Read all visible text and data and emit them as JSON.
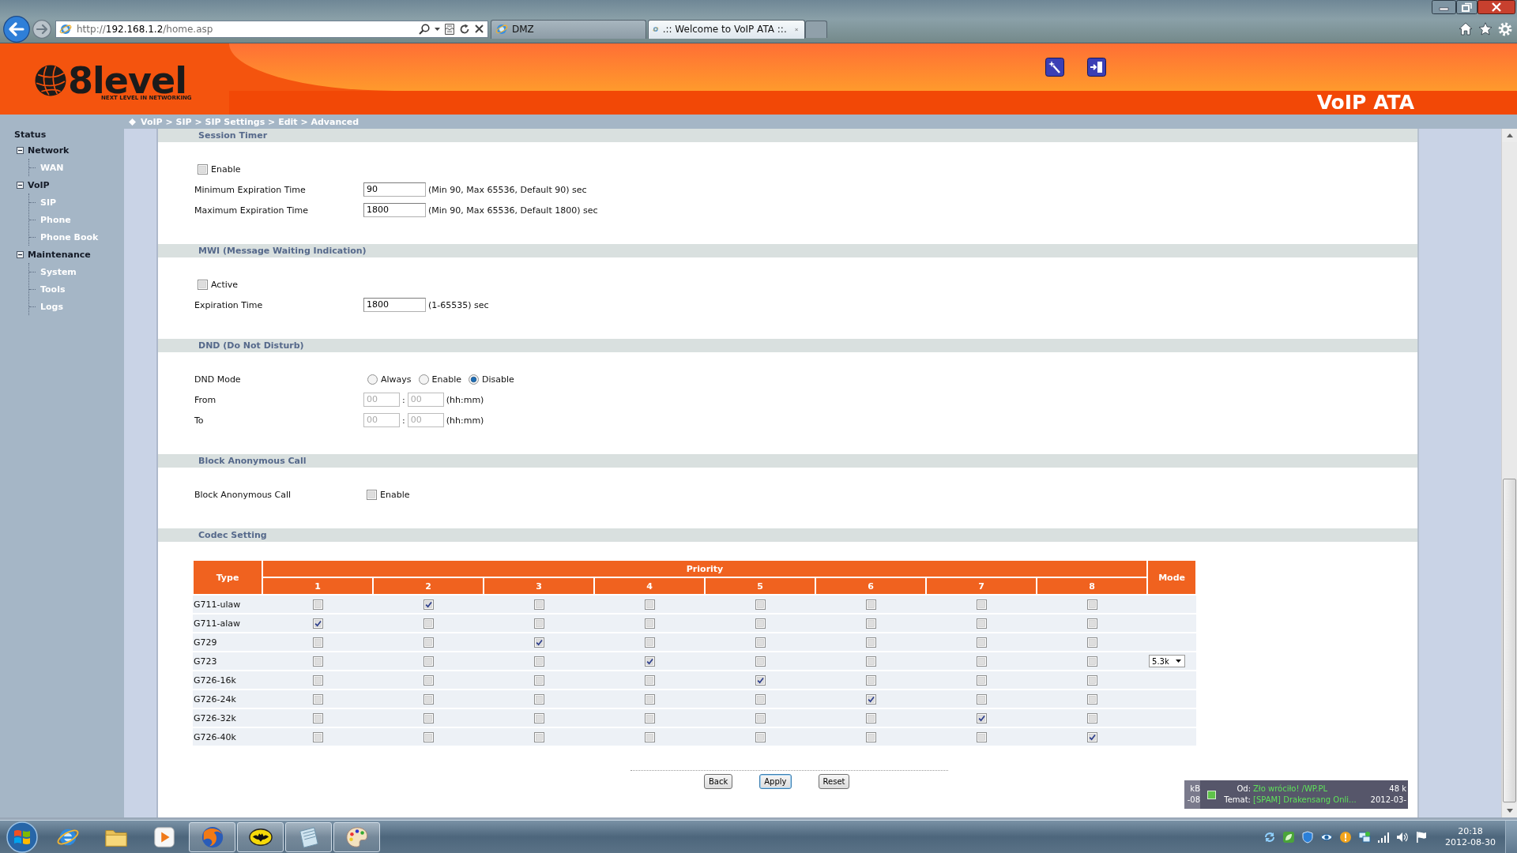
{
  "browser": {
    "address": {
      "scheme": "http://",
      "host": "192.168.1.2",
      "path": "/home.asp"
    },
    "tabs": [
      {
        "label": "DMZ",
        "selected": false
      },
      {
        "label": ".:: Welcome to VoIP ATA ::.",
        "selected": true
      }
    ]
  },
  "header": {
    "logo": "8level",
    "tagline": "NEXT LEVEL IN NETWORKING",
    "product": "VoIP ATA"
  },
  "breadcrumb": "VoIP > SIP > SIP Settings > Edit > Advanced",
  "sidebar": {
    "title": "Status",
    "items": [
      {
        "label": "Network",
        "expanded": true,
        "children": [
          {
            "label": "WAN"
          }
        ]
      },
      {
        "label": "VoIP",
        "expanded": true,
        "children": [
          {
            "label": "SIP"
          },
          {
            "label": "Phone"
          },
          {
            "label": "Phone Book"
          }
        ]
      },
      {
        "label": "Maintenance",
        "expanded": true,
        "children": [
          {
            "label": "System"
          },
          {
            "label": "Tools"
          },
          {
            "label": "Logs"
          }
        ]
      }
    ]
  },
  "sections": [
    {
      "title": "Session Timer",
      "rows": [
        {
          "kind": "checkbox",
          "label": "Enable",
          "checked": false
        },
        {
          "kind": "text",
          "label": "Minimum Expiration Time",
          "value": "90",
          "note": "(Min 90, Max 65536, Default 90) sec"
        },
        {
          "kind": "text",
          "label": "Maximum Expiration Time",
          "value": "1800",
          "note": "(Min 90, Max 65536, Default 1800) sec"
        }
      ]
    },
    {
      "title": "MWI (Message Waiting Indication)",
      "rows": [
        {
          "kind": "checkbox",
          "label": "Active",
          "checked": false
        },
        {
          "kind": "text",
          "label": "Expiration Time",
          "value": "1800",
          "note": "(1-65535) sec"
        }
      ]
    },
    {
      "title": "DND (Do Not Disturb)",
      "rows": [
        {
          "kind": "radio",
          "label": "DND Mode",
          "options": [
            {
              "label": "Always",
              "selected": false
            },
            {
              "label": "Enable",
              "selected": false
            },
            {
              "label": "Disable",
              "selected": true
            }
          ]
        },
        {
          "kind": "time",
          "label": "From",
          "hours": "00",
          "separator": ":",
          "minutes": "00",
          "note": "(hh:mm)",
          "disabled": true
        },
        {
          "kind": "time",
          "label": "To",
          "hours": "00",
          "separator": ":",
          "minutes": "00",
          "note": "(hh:mm)",
          "disabled": true
        }
      ]
    },
    {
      "title": "Block Anonymous Call",
      "rows": [
        {
          "kind": "option",
          "label": "Block Anonymous Call",
          "option": "Enable",
          "checked": false
        }
      ]
    }
  ],
  "codec": {
    "title": "Codec Setting",
    "type_heading": "Type",
    "priority_heading": "Priority",
    "mode_heading": "Mode",
    "priorities": [
      "1",
      "2",
      "3",
      "4",
      "5",
      "6",
      "7",
      "8"
    ],
    "rows": [
      {
        "type": "G711-ulaw",
        "checked": [
          false,
          true,
          false,
          false,
          false,
          false,
          false,
          false
        ]
      },
      {
        "type": "G711-alaw",
        "checked": [
          true,
          false,
          false,
          false,
          false,
          false,
          false,
          false
        ]
      },
      {
        "type": "G729",
        "checked": [
          false,
          false,
          true,
          false,
          false,
          false,
          false,
          false
        ]
      },
      {
        "type": "G723",
        "checked": [
          false,
          false,
          false,
          true,
          false,
          false,
          false,
          false
        ],
        "mode": "5.3k"
      },
      {
        "type": "G726-16k",
        "checked": [
          false,
          false,
          false,
          false,
          true,
          false,
          false,
          false
        ]
      },
      {
        "type": "G726-24k",
        "checked": [
          false,
          false,
          false,
          false,
          false,
          true,
          false,
          false
        ]
      },
      {
        "type": "G726-32k",
        "checked": [
          false,
          false,
          false,
          false,
          false,
          false,
          true,
          false
        ]
      },
      {
        "type": "G726-40k",
        "checked": [
          false,
          false,
          false,
          false,
          false,
          false,
          false,
          true
        ]
      }
    ]
  },
  "buttons": [
    {
      "label": "Back",
      "focused": false
    },
    {
      "label": "Apply",
      "focused": true
    },
    {
      "label": "Reset",
      "focused": false
    }
  ],
  "notification": {
    "size_cut": "kB",
    "date_cut": "-08",
    "from_label": "Od:",
    "from": "Zło wróciło! /WP.PL",
    "size": "48 k",
    "subject_label": "Temat:",
    "subject": "[SPAM] Drakensang Onli...",
    "date": "2012-03-"
  },
  "taskbar": {
    "apps": [
      {
        "kind": "ring-globe",
        "running": false
      },
      {
        "kind": "folder",
        "running": false
      },
      {
        "kind": "play",
        "running": false
      },
      {
        "kind": "fox-globe",
        "running": true
      },
      {
        "kind": "bat",
        "running": true
      },
      {
        "kind": "notepad",
        "running": true
      },
      {
        "kind": "palette",
        "running": true
      }
    ],
    "time": "20:18",
    "date": "2012-08-30"
  }
}
